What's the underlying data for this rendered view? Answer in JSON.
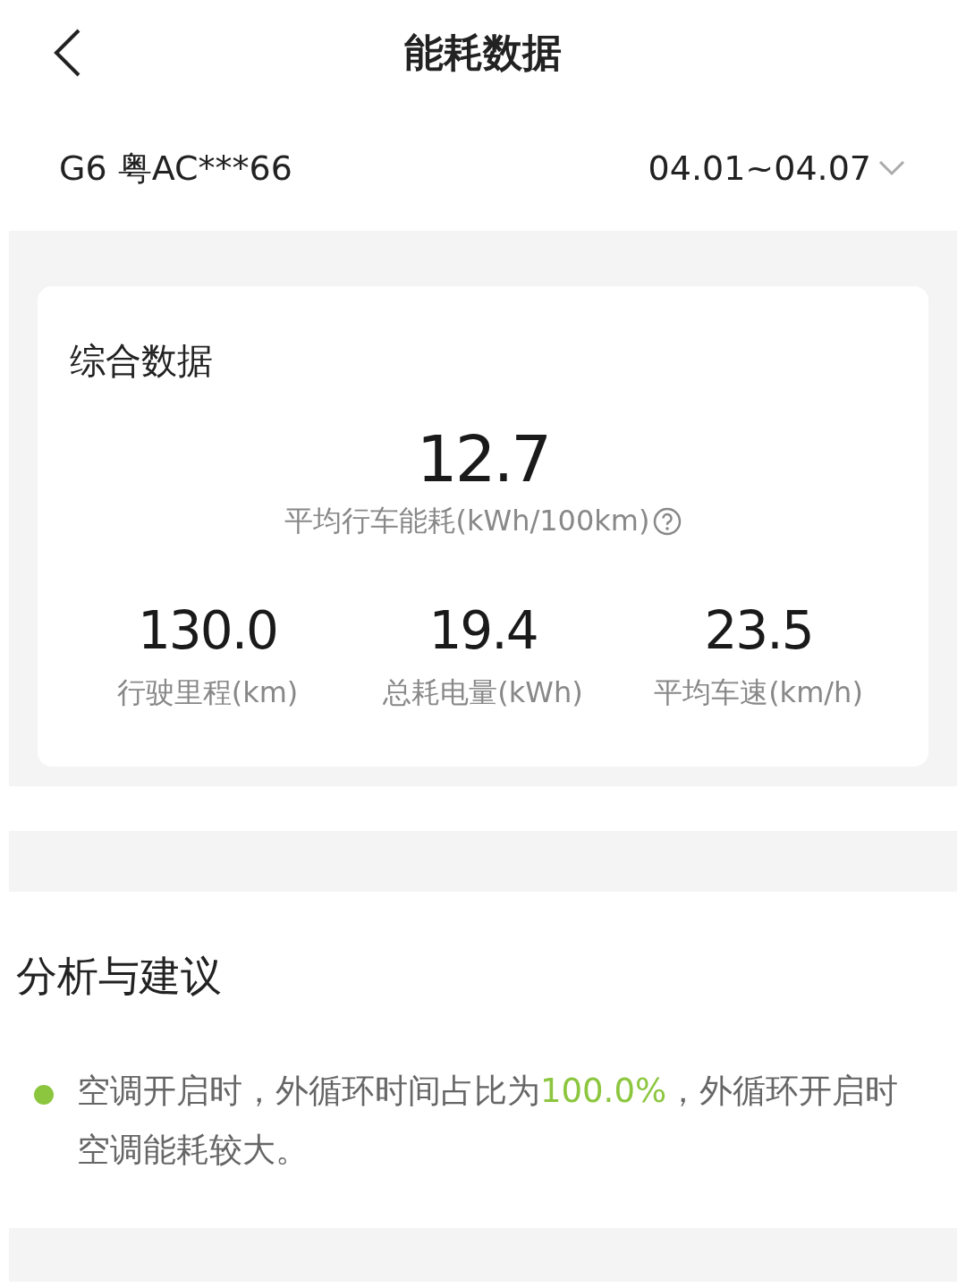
{
  "header": {
    "title": "能耗数据"
  },
  "vehicle": {
    "name": "G6 粤AC***66",
    "date_range": "04.01~04.07"
  },
  "summary": {
    "title": "综合数据",
    "main": {
      "value": "12.7",
      "label": "平均行车能耗(kWh/100km)"
    },
    "stats": [
      {
        "value": "130.0",
        "label": "行驶里程(km)"
      },
      {
        "value": "19.4",
        "label": "总耗电量(kWh)"
      },
      {
        "value": "23.5",
        "label": "平均车速(km/h)"
      }
    ]
  },
  "analysis": {
    "title": "分析与建议",
    "items": [
      {
        "text": "空调开启时，外循环时间占比为**100.0%**，外循环开启时空调能耗较大。",
        "color": "#8cc63f"
      }
    ]
  }
}
